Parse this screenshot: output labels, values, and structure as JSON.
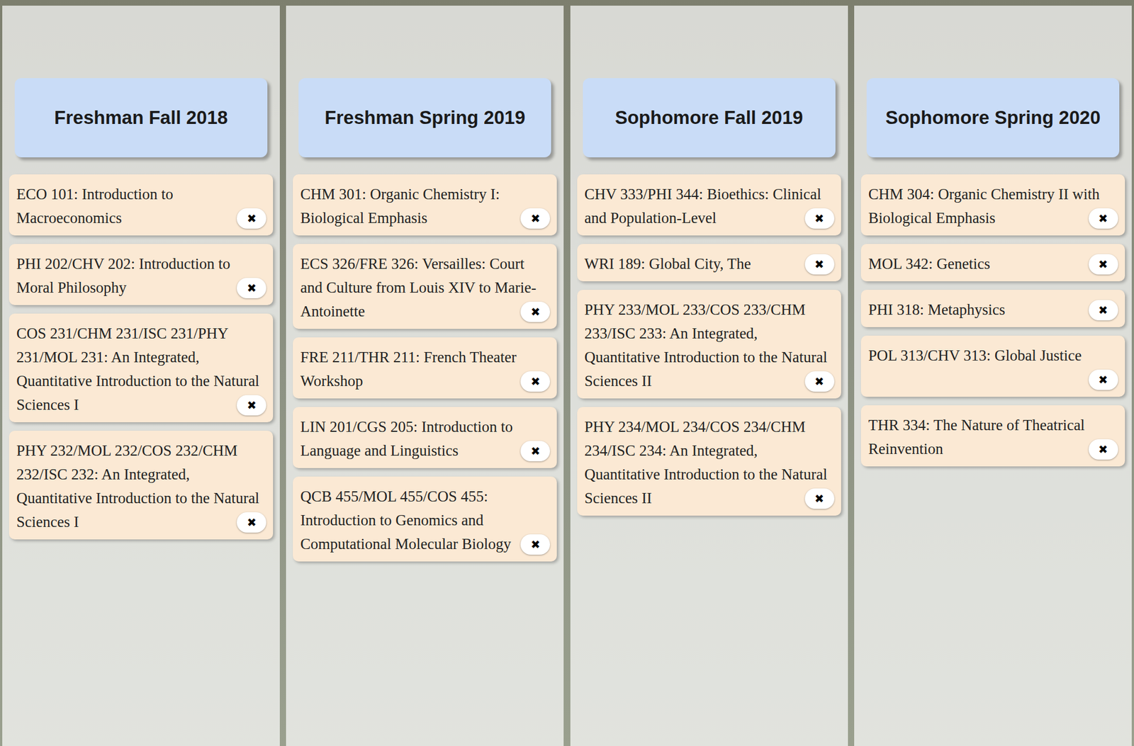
{
  "semesters": [
    {
      "title": "Freshman Fall 2018",
      "courses": [
        {
          "title": "ECO 101: Introduction to Macroeconomics",
          "remove": "✖"
        },
        {
          "title": "PHI 202/CHV 202: Introduction to Moral Philosophy",
          "remove": "✖"
        },
        {
          "title": "COS 231/CHM 231/ISC 231/PHY 231/MOL 231: An Integrated, Quantitative Introduction to the Natural Sciences I",
          "remove": "✖"
        },
        {
          "title": "PHY 232/MOL 232/COS 232/CHM 232/ISC 232: An Integrated, Quantitative Introduction to the Natural Sciences I",
          "remove": "✖"
        }
      ]
    },
    {
      "title": "Freshman Spring 2019",
      "courses": [
        {
          "title": "CHM 301: Organic Chemistry I: Biological Emphasis",
          "remove": "✖"
        },
        {
          "title": "ECS 326/FRE 326: Versailles: Court and Culture from Louis XIV to Marie-Antoinette",
          "remove": "✖"
        },
        {
          "title": "FRE 211/THR 211: French Theater Workshop",
          "remove": "✖"
        },
        {
          "title": "LIN 201/CGS 205: Introduction to Language and Linguistics",
          "remove": "✖"
        },
        {
          "title": "QCB 455/MOL 455/COS 455: Introduction to Genomics and Computational Molecular Biology",
          "remove": "✖"
        }
      ]
    },
    {
      "title": "Sophomore Fall 2019",
      "courses": [
        {
          "title": "CHV 333/PHI 344: Bioethics: Clinical and Population-Level",
          "remove": "✖"
        },
        {
          "title": "WRI 189: Global City, The",
          "remove": "✖"
        },
        {
          "title": "PHY 233/MOL 233/COS 233/CHM 233/ISC 233: An Integrated, Quantitative Introduction to the Natural Sciences II",
          "remove": "✖"
        },
        {
          "title": "PHY 234/MOL 234/COS 234/CHM 234/ISC 234: An Integrated, Quantitative Introduction to the Natural Sciences II",
          "remove": "✖"
        }
      ]
    },
    {
      "title": "Sophomore Spring 2020",
      "courses": [
        {
          "title": "CHM 304: Organic Chemistry II with Biological Emphasis",
          "remove": "✖"
        },
        {
          "title": "MOL 342: Genetics",
          "remove": "✖"
        },
        {
          "title": "PHI 318: Metaphysics",
          "remove": "✖"
        },
        {
          "title": "POL 313/CHV 313: Global Justice",
          "remove": "✖"
        },
        {
          "title": "THR 334: The Nature of Theatrical Reinvention",
          "remove": "✖"
        }
      ]
    }
  ]
}
